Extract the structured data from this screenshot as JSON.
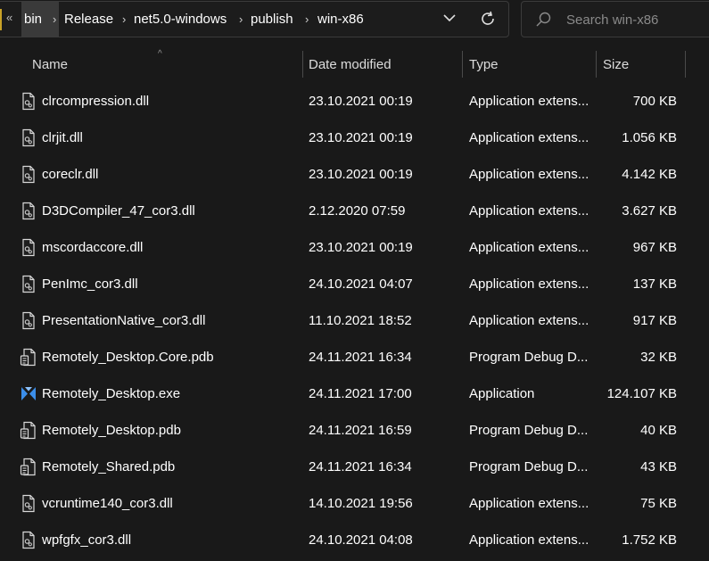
{
  "address_bar": {
    "overflow": "«",
    "crumbs": [
      "bin",
      "Release",
      "net5.0-windows",
      "publish",
      "win-x86"
    ]
  },
  "search": {
    "placeholder": "Search win-x86"
  },
  "columns": {
    "name": "Name",
    "date": "Date modified",
    "type": "Type",
    "size": "Size"
  },
  "files": [
    {
      "name": "clrcompression.dll",
      "date": "23.10.2021 00:19",
      "type": "Application extens...",
      "size": "700 KB",
      "icon": "dll-file-icon"
    },
    {
      "name": "clrjit.dll",
      "date": "23.10.2021 00:19",
      "type": "Application extens...",
      "size": "1.056 KB",
      "icon": "dll-file-icon"
    },
    {
      "name": "coreclr.dll",
      "date": "23.10.2021 00:19",
      "type": "Application extens...",
      "size": "4.142 KB",
      "icon": "dll-file-icon"
    },
    {
      "name": "D3DCompiler_47_cor3.dll",
      "date": "2.12.2020 07:59",
      "type": "Application extens...",
      "size": "3.627 KB",
      "icon": "dll-file-icon"
    },
    {
      "name": "mscordaccore.dll",
      "date": "23.10.2021 00:19",
      "type": "Application extens...",
      "size": "967 KB",
      "icon": "dll-file-icon"
    },
    {
      "name": "PenImc_cor3.dll",
      "date": "24.10.2021 04:07",
      "type": "Application extens...",
      "size": "137 KB",
      "icon": "dll-file-icon"
    },
    {
      "name": "PresentationNative_cor3.dll",
      "date": "11.10.2021 18:52",
      "type": "Application extens...",
      "size": "917 KB",
      "icon": "dll-file-icon"
    },
    {
      "name": "Remotely_Desktop.Core.pdb",
      "date": "24.11.2021 16:34",
      "type": "Program Debug D...",
      "size": "32 KB",
      "icon": "pdb-file-icon"
    },
    {
      "name": "Remotely_Desktop.exe",
      "date": "24.11.2021 17:00",
      "type": "Application",
      "size": "124.107 KB",
      "icon": "remotely-app-icon"
    },
    {
      "name": "Remotely_Desktop.pdb",
      "date": "24.11.2021 16:59",
      "type": "Program Debug D...",
      "size": "40 KB",
      "icon": "pdb-file-icon"
    },
    {
      "name": "Remotely_Shared.pdb",
      "date": "24.11.2021 16:34",
      "type": "Program Debug D...",
      "size": "43 KB",
      "icon": "pdb-file-icon"
    },
    {
      "name": "vcruntime140_cor3.dll",
      "date": "14.10.2021 19:56",
      "type": "Application extens...",
      "size": "75 KB",
      "icon": "dll-file-icon"
    },
    {
      "name": "wpfgfx_cor3.dll",
      "date": "24.10.2021 04:08",
      "type": "Application extens...",
      "size": "1.752 KB",
      "icon": "dll-file-icon"
    }
  ],
  "colors": {
    "background": "#191919",
    "text": "#ffffff",
    "accent_blue": "#3b8eea"
  }
}
